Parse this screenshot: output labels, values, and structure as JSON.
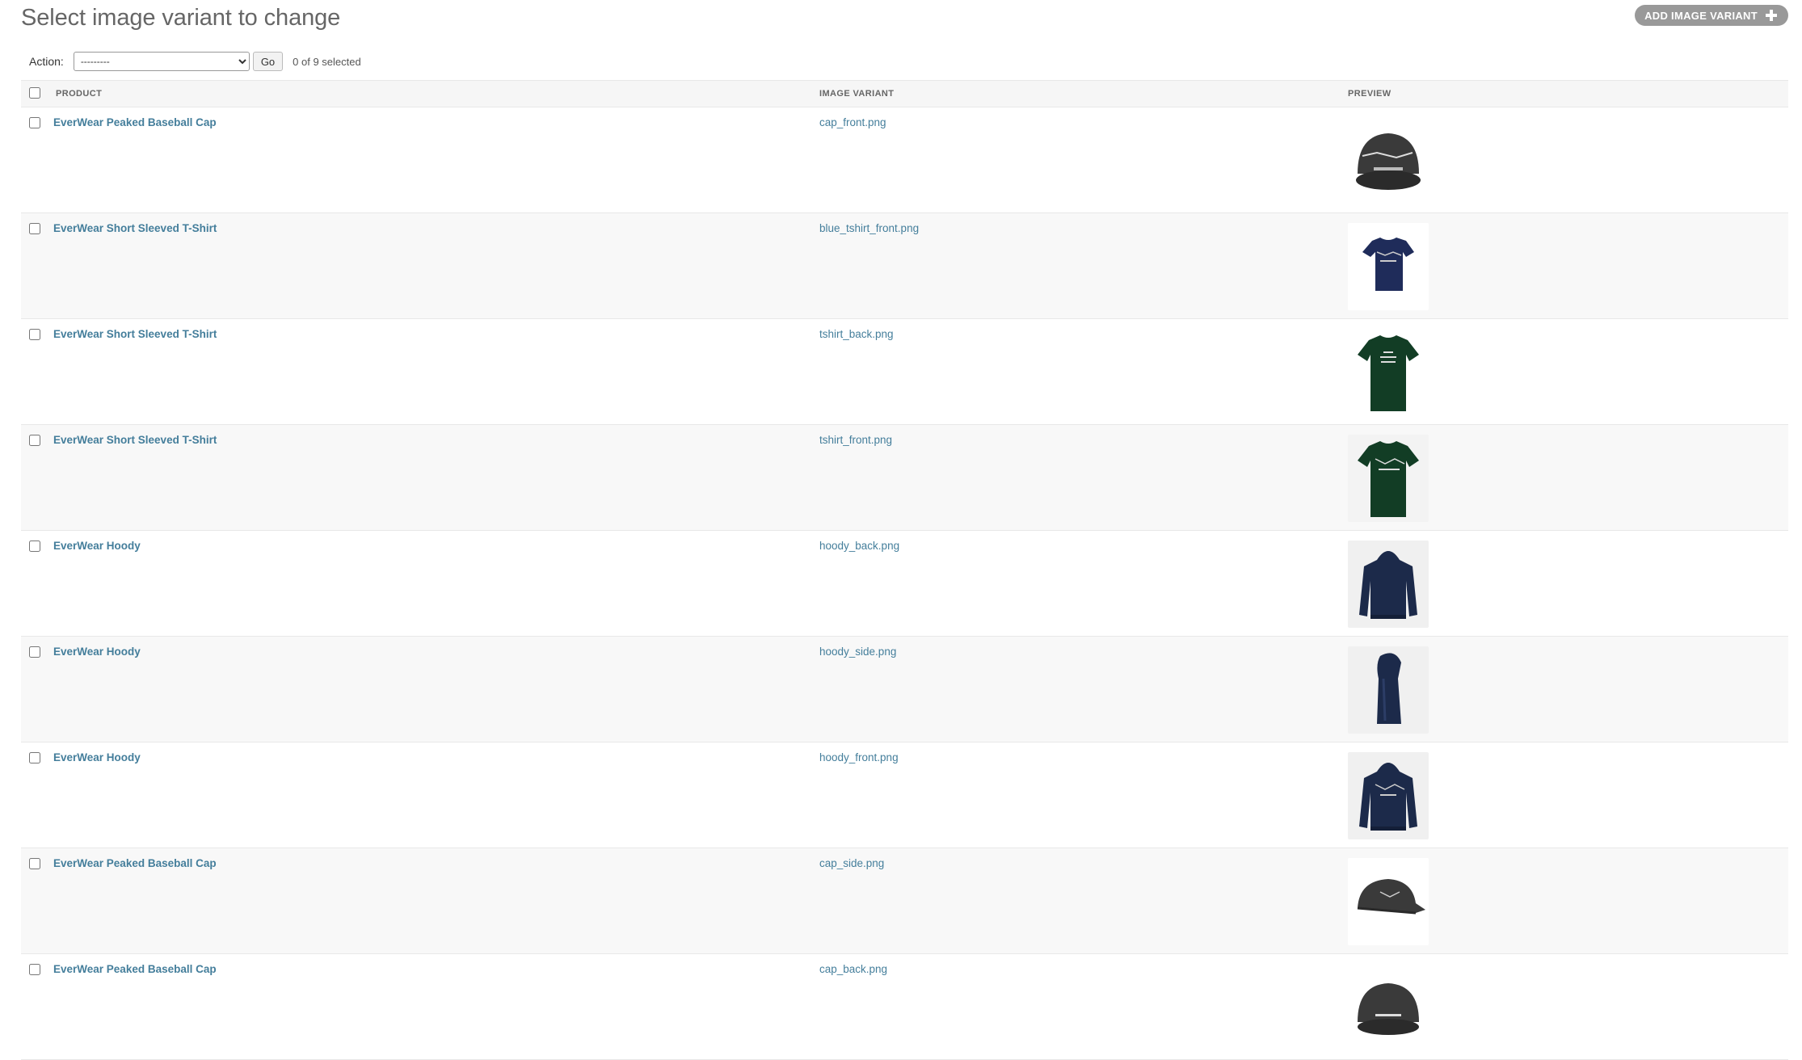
{
  "page": {
    "title": "Select image variant to change",
    "add_button_label": "ADD IMAGE VARIANT"
  },
  "actions": {
    "label": "Action:",
    "select_value": "---------",
    "go_label": "Go",
    "selection_count": "0 of 9 selected"
  },
  "table": {
    "columns": [
      "PRODUCT",
      "IMAGE VARIANT",
      "PREVIEW"
    ],
    "rows": [
      {
        "product": "EverWear Peaked Baseball Cap",
        "variant": "cap_front.png",
        "preview": "cap-front-image"
      },
      {
        "product": "EverWear Short Sleeved T-Shirt",
        "variant": "blue_tshirt_front.png",
        "preview": "blue-tshirt-front-image"
      },
      {
        "product": "EverWear Short Sleeved T-Shirt",
        "variant": "tshirt_back.png",
        "preview": "green-tshirt-back-image"
      },
      {
        "product": "EverWear Short Sleeved T-Shirt",
        "variant": "tshirt_front.png",
        "preview": "green-tshirt-front-image"
      },
      {
        "product": "EverWear Hoody",
        "variant": "hoody_back.png",
        "preview": "hoody-back-image"
      },
      {
        "product": "EverWear Hoody",
        "variant": "hoody_side.png",
        "preview": "hoody-side-image"
      },
      {
        "product": "EverWear Hoody",
        "variant": "hoody_front.png",
        "preview": "hoody-front-image"
      },
      {
        "product": "EverWear Peaked Baseball Cap",
        "variant": "cap_side.png",
        "preview": "cap-side-image"
      },
      {
        "product": "EverWear Peaked Baseball Cap",
        "variant": "cap_back.png",
        "preview": "cap-back-image"
      }
    ]
  },
  "colors": {
    "link": "#447e9b",
    "header_bg": "#f6f6f6",
    "button_bg": "#999999",
    "cap": "#3a3a3a",
    "navy": "#1c2a4a",
    "green": "#123d25"
  }
}
